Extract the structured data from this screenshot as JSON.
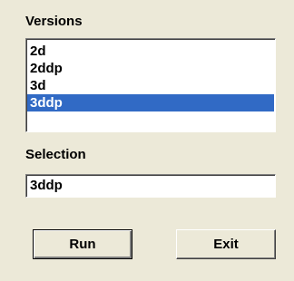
{
  "versions": {
    "label": "Versions",
    "items": [
      "2d",
      "2ddp",
      "3d",
      "3ddp"
    ],
    "selected": "3ddp"
  },
  "selection": {
    "label": "Selection",
    "value": "3ddp"
  },
  "buttons": {
    "run_label": "Run",
    "exit_label": "Exit"
  },
  "colors": {
    "dialog_background": "#ece9d8",
    "selection_highlight": "#316ac5"
  }
}
